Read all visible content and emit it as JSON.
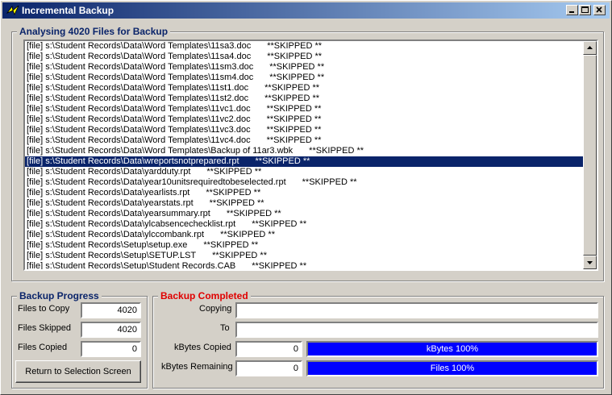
{
  "window": {
    "title": "Incremental Backup"
  },
  "analysis": {
    "group_title": "Analysing 4020 Files for Backup",
    "items": [
      {
        "path": "[file] s:\\Student Records\\Data\\Word Templates\\11sa3.doc",
        "status": "**SKIPPED **"
      },
      {
        "path": "[file] s:\\Student Records\\Data\\Word Templates\\11sa4.doc",
        "status": "**SKIPPED **"
      },
      {
        "path": "[file] s:\\Student Records\\Data\\Word Templates\\11sm3.doc",
        "status": "**SKIPPED **"
      },
      {
        "path": "[file] s:\\Student Records\\Data\\Word Templates\\11sm4.doc",
        "status": "**SKIPPED **"
      },
      {
        "path": "[file] s:\\Student Records\\Data\\Word Templates\\11st1.doc",
        "status": "**SKIPPED **"
      },
      {
        "path": "[file] s:\\Student Records\\Data\\Word Templates\\11st2.doc",
        "status": "**SKIPPED **"
      },
      {
        "path": "[file] s:\\Student Records\\Data\\Word Templates\\11vc1.doc",
        "status": "**SKIPPED **"
      },
      {
        "path": "[file] s:\\Student Records\\Data\\Word Templates\\11vc2.doc",
        "status": "**SKIPPED **"
      },
      {
        "path": "[file] s:\\Student Records\\Data\\Word Templates\\11vc3.doc",
        "status": "**SKIPPED **"
      },
      {
        "path": "[file] s:\\Student Records\\Data\\Word Templates\\11vc4.doc",
        "status": "**SKIPPED **"
      },
      {
        "path": "[file] s:\\Student Records\\Data\\Word Templates\\Backup of 11ar3.wbk",
        "status": "**SKIPPED **"
      },
      {
        "path": "[file] s:\\Student Records\\Data\\wreportsnotprepared.rpt",
        "status": "**SKIPPED **",
        "selected": true
      },
      {
        "path": "[file] s:\\Student Records\\Data\\yardduty.rpt",
        "status": "**SKIPPED **"
      },
      {
        "path": "[file] s:\\Student Records\\Data\\year10unitsrequiredtobeselected.rpt",
        "status": "**SKIPPED **"
      },
      {
        "path": "[file] s:\\Student Records\\Data\\yearlists.rpt",
        "status": "**SKIPPED **"
      },
      {
        "path": "[file] s:\\Student Records\\Data\\yearstats.rpt",
        "status": "**SKIPPED **"
      },
      {
        "path": "[file] s:\\Student Records\\Data\\yearsummary.rpt",
        "status": "**SKIPPED **"
      },
      {
        "path": "[file] s:\\Student Records\\Data\\ylcabsencechecklist.rpt",
        "status": "**SKIPPED **"
      },
      {
        "path": "[file] s:\\Student Records\\Data\\ylccombank.rpt",
        "status": "**SKIPPED **"
      },
      {
        "path": "[file] s:\\Student Records\\Setup\\setup.exe",
        "status": "**SKIPPED **"
      },
      {
        "path": "[file] s:\\Student Records\\Setup\\SETUP.LST",
        "status": "**SKIPPED **"
      },
      {
        "path": "[file] s:\\Student Records\\Setup\\Student Records.CAB",
        "status": "**SKIPPED **"
      }
    ]
  },
  "progress": {
    "group_title": "Backup Progress",
    "files_to_copy_label": "Files to Copy",
    "files_to_copy": "4020",
    "files_skipped_label": "Files Skipped",
    "files_skipped": "4020",
    "files_copied_label": "Files Copied",
    "files_copied": "0",
    "return_button": "Return to Selection Screen"
  },
  "completed": {
    "group_title": "Backup Completed",
    "copying_label": "Copying",
    "copying_value": "",
    "to_label": "To",
    "to_value": "",
    "kbytes_copied_label": "kBytes Copied",
    "kbytes_copied": "0",
    "kbytes_bar_text": "kBytes 100%",
    "kbytes_fraction": 1.0,
    "kbytes_remaining_label": "kBytes Remaining",
    "kbytes_remaining": "0",
    "files_bar_text": "Files 100%",
    "files_fraction": 1.0
  },
  "colors": {
    "titlebar_start": "#0a246a",
    "titlebar_end": "#a6caf0",
    "selection": "#0a246a",
    "progress_fill": "#0000ff",
    "completed_title": "#e00000"
  }
}
